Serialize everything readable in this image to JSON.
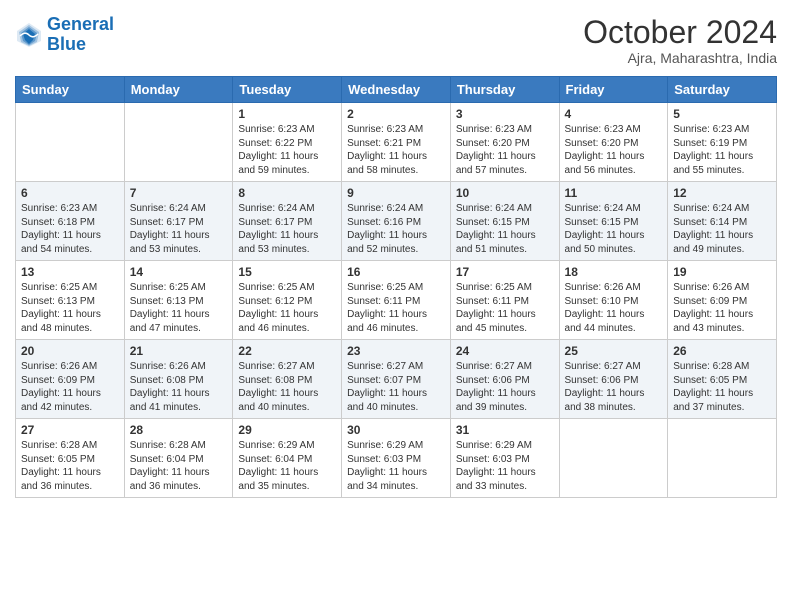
{
  "logo": {
    "line1": "General",
    "line2": "Blue"
  },
  "title": "October 2024",
  "location": "Ajra, Maharashtra, India",
  "days_of_week": [
    "Sunday",
    "Monday",
    "Tuesday",
    "Wednesday",
    "Thursday",
    "Friday",
    "Saturday"
  ],
  "weeks": [
    [
      {
        "day": "",
        "sunrise": "",
        "sunset": "",
        "daylight": ""
      },
      {
        "day": "",
        "sunrise": "",
        "sunset": "",
        "daylight": ""
      },
      {
        "day": "1",
        "sunrise": "Sunrise: 6:23 AM",
        "sunset": "Sunset: 6:22 PM",
        "daylight": "Daylight: 11 hours and 59 minutes."
      },
      {
        "day": "2",
        "sunrise": "Sunrise: 6:23 AM",
        "sunset": "Sunset: 6:21 PM",
        "daylight": "Daylight: 11 hours and 58 minutes."
      },
      {
        "day": "3",
        "sunrise": "Sunrise: 6:23 AM",
        "sunset": "Sunset: 6:20 PM",
        "daylight": "Daylight: 11 hours and 57 minutes."
      },
      {
        "day": "4",
        "sunrise": "Sunrise: 6:23 AM",
        "sunset": "Sunset: 6:20 PM",
        "daylight": "Daylight: 11 hours and 56 minutes."
      },
      {
        "day": "5",
        "sunrise": "Sunrise: 6:23 AM",
        "sunset": "Sunset: 6:19 PM",
        "daylight": "Daylight: 11 hours and 55 minutes."
      }
    ],
    [
      {
        "day": "6",
        "sunrise": "Sunrise: 6:23 AM",
        "sunset": "Sunset: 6:18 PM",
        "daylight": "Daylight: 11 hours and 54 minutes."
      },
      {
        "day": "7",
        "sunrise": "Sunrise: 6:24 AM",
        "sunset": "Sunset: 6:17 PM",
        "daylight": "Daylight: 11 hours and 53 minutes."
      },
      {
        "day": "8",
        "sunrise": "Sunrise: 6:24 AM",
        "sunset": "Sunset: 6:17 PM",
        "daylight": "Daylight: 11 hours and 53 minutes."
      },
      {
        "day": "9",
        "sunrise": "Sunrise: 6:24 AM",
        "sunset": "Sunset: 6:16 PM",
        "daylight": "Daylight: 11 hours and 52 minutes."
      },
      {
        "day": "10",
        "sunrise": "Sunrise: 6:24 AM",
        "sunset": "Sunset: 6:15 PM",
        "daylight": "Daylight: 11 hours and 51 minutes."
      },
      {
        "day": "11",
        "sunrise": "Sunrise: 6:24 AM",
        "sunset": "Sunset: 6:15 PM",
        "daylight": "Daylight: 11 hours and 50 minutes."
      },
      {
        "day": "12",
        "sunrise": "Sunrise: 6:24 AM",
        "sunset": "Sunset: 6:14 PM",
        "daylight": "Daylight: 11 hours and 49 minutes."
      }
    ],
    [
      {
        "day": "13",
        "sunrise": "Sunrise: 6:25 AM",
        "sunset": "Sunset: 6:13 PM",
        "daylight": "Daylight: 11 hours and 48 minutes."
      },
      {
        "day": "14",
        "sunrise": "Sunrise: 6:25 AM",
        "sunset": "Sunset: 6:13 PM",
        "daylight": "Daylight: 11 hours and 47 minutes."
      },
      {
        "day": "15",
        "sunrise": "Sunrise: 6:25 AM",
        "sunset": "Sunset: 6:12 PM",
        "daylight": "Daylight: 11 hours and 46 minutes."
      },
      {
        "day": "16",
        "sunrise": "Sunrise: 6:25 AM",
        "sunset": "Sunset: 6:11 PM",
        "daylight": "Daylight: 11 hours and 46 minutes."
      },
      {
        "day": "17",
        "sunrise": "Sunrise: 6:25 AM",
        "sunset": "Sunset: 6:11 PM",
        "daylight": "Daylight: 11 hours and 45 minutes."
      },
      {
        "day": "18",
        "sunrise": "Sunrise: 6:26 AM",
        "sunset": "Sunset: 6:10 PM",
        "daylight": "Daylight: 11 hours and 44 minutes."
      },
      {
        "day": "19",
        "sunrise": "Sunrise: 6:26 AM",
        "sunset": "Sunset: 6:09 PM",
        "daylight": "Daylight: 11 hours and 43 minutes."
      }
    ],
    [
      {
        "day": "20",
        "sunrise": "Sunrise: 6:26 AM",
        "sunset": "Sunset: 6:09 PM",
        "daylight": "Daylight: 11 hours and 42 minutes."
      },
      {
        "day": "21",
        "sunrise": "Sunrise: 6:26 AM",
        "sunset": "Sunset: 6:08 PM",
        "daylight": "Daylight: 11 hours and 41 minutes."
      },
      {
        "day": "22",
        "sunrise": "Sunrise: 6:27 AM",
        "sunset": "Sunset: 6:08 PM",
        "daylight": "Daylight: 11 hours and 40 minutes."
      },
      {
        "day": "23",
        "sunrise": "Sunrise: 6:27 AM",
        "sunset": "Sunset: 6:07 PM",
        "daylight": "Daylight: 11 hours and 40 minutes."
      },
      {
        "day": "24",
        "sunrise": "Sunrise: 6:27 AM",
        "sunset": "Sunset: 6:06 PM",
        "daylight": "Daylight: 11 hours and 39 minutes."
      },
      {
        "day": "25",
        "sunrise": "Sunrise: 6:27 AM",
        "sunset": "Sunset: 6:06 PM",
        "daylight": "Daylight: 11 hours and 38 minutes."
      },
      {
        "day": "26",
        "sunrise": "Sunrise: 6:28 AM",
        "sunset": "Sunset: 6:05 PM",
        "daylight": "Daylight: 11 hours and 37 minutes."
      }
    ],
    [
      {
        "day": "27",
        "sunrise": "Sunrise: 6:28 AM",
        "sunset": "Sunset: 6:05 PM",
        "daylight": "Daylight: 11 hours and 36 minutes."
      },
      {
        "day": "28",
        "sunrise": "Sunrise: 6:28 AM",
        "sunset": "Sunset: 6:04 PM",
        "daylight": "Daylight: 11 hours and 36 minutes."
      },
      {
        "day": "29",
        "sunrise": "Sunrise: 6:29 AM",
        "sunset": "Sunset: 6:04 PM",
        "daylight": "Daylight: 11 hours and 35 minutes."
      },
      {
        "day": "30",
        "sunrise": "Sunrise: 6:29 AM",
        "sunset": "Sunset: 6:03 PM",
        "daylight": "Daylight: 11 hours and 34 minutes."
      },
      {
        "day": "31",
        "sunrise": "Sunrise: 6:29 AM",
        "sunset": "Sunset: 6:03 PM",
        "daylight": "Daylight: 11 hours and 33 minutes."
      },
      {
        "day": "",
        "sunrise": "",
        "sunset": "",
        "daylight": ""
      },
      {
        "day": "",
        "sunrise": "",
        "sunset": "",
        "daylight": ""
      }
    ]
  ]
}
